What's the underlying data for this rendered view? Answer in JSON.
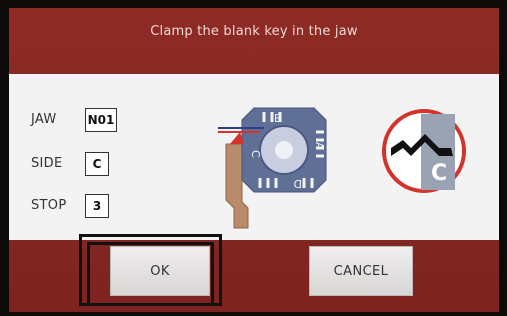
{
  "header": {
    "title": "Clamp the blank key in the jaw"
  },
  "settings": [
    {
      "label": "JAW",
      "value": "N01"
    },
    {
      "label": "SIDE",
      "value": "C"
    },
    {
      "label": "STOP",
      "value": "3"
    }
  ],
  "diagram": {
    "jaw_face_letters": [
      "B",
      "A",
      "C",
      "D"
    ],
    "cut_type_letter": "C"
  },
  "buttons": {
    "ok": "OK",
    "cancel": "CANCEL"
  },
  "colors": {
    "background_red": "#8e2b25",
    "jaw_blue": "#5f6f96",
    "key_brown": "#b98b6b",
    "circle_red": "#d2342c"
  }
}
